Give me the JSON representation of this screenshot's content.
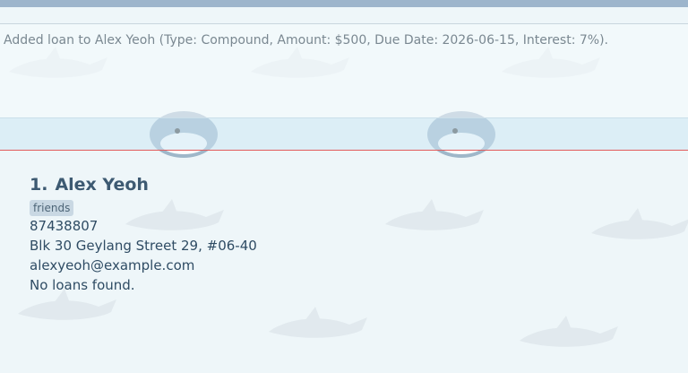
{
  "result": {
    "message": "Added loan to Alex Yeoh (Type: Compound, Amount: $500, Due Date: 2026-06-15, Interest: 7%)."
  },
  "person": {
    "index": "1.",
    "name": "Alex Yeoh",
    "tags": [
      "friends"
    ],
    "phone": "87438807",
    "address": "Blk 30 Geylang Street 29, #06-40",
    "email": "alexyeoh@example.com",
    "loans": "No loans found."
  },
  "colors": {
    "accent_line": "#e25c5c",
    "top_strip": "#9db5cc",
    "name_text": "#3d5a72"
  }
}
